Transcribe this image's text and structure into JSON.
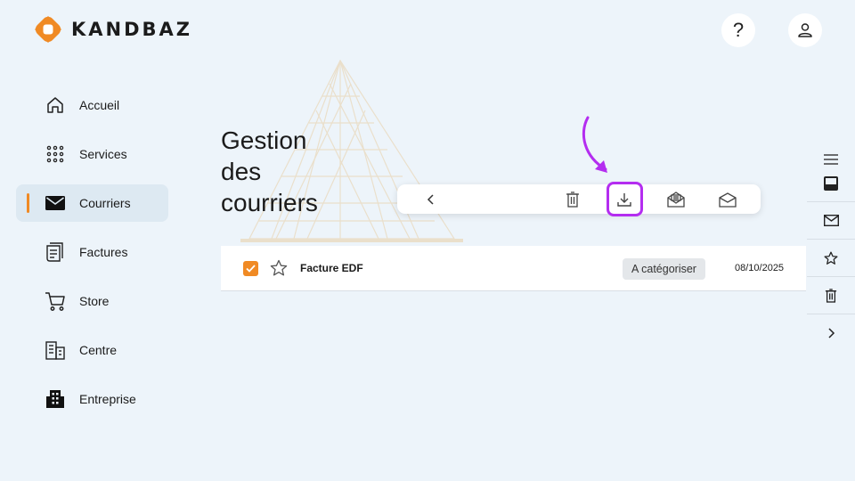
{
  "brand": {
    "name": "KANDBAZ",
    "accent": "#f08a24"
  },
  "header": {
    "help_label": "?",
    "help_icon": "question-icon",
    "user_icon": "user-icon"
  },
  "sidebar": {
    "items": [
      {
        "label": "Accueil",
        "icon": "home-icon",
        "active": false
      },
      {
        "label": "Services",
        "icon": "grid-dots-icon",
        "active": false
      },
      {
        "label": "Courriers",
        "icon": "mail-icon",
        "active": true
      },
      {
        "label": "Factures",
        "icon": "invoice-icon",
        "active": false
      },
      {
        "label": "Store",
        "icon": "cart-icon",
        "active": false
      },
      {
        "label": "Centre",
        "icon": "building-icon",
        "active": false
      },
      {
        "label": "Entreprise",
        "icon": "enterprise-icon",
        "active": false
      }
    ]
  },
  "page": {
    "title_line1": "Gestion",
    "title_line2": "des",
    "title_line3": "courriers"
  },
  "toolbar": {
    "buttons": [
      "back-icon",
      "trash-icon",
      "download-icon",
      "mail-open-icon",
      "mark-unread-icon"
    ],
    "highlight_color": "#b42df0"
  },
  "mail": {
    "rows": [
      {
        "subject": "Facture EDF",
        "tag": "A catégoriser",
        "date": "08/10/2025",
        "checked": true,
        "starred": false
      }
    ]
  },
  "rail": {
    "items": [
      "menu-icon",
      "inbox-icon",
      "mail-icon",
      "star-icon",
      "trash-icon",
      "chevron-right-icon"
    ]
  }
}
